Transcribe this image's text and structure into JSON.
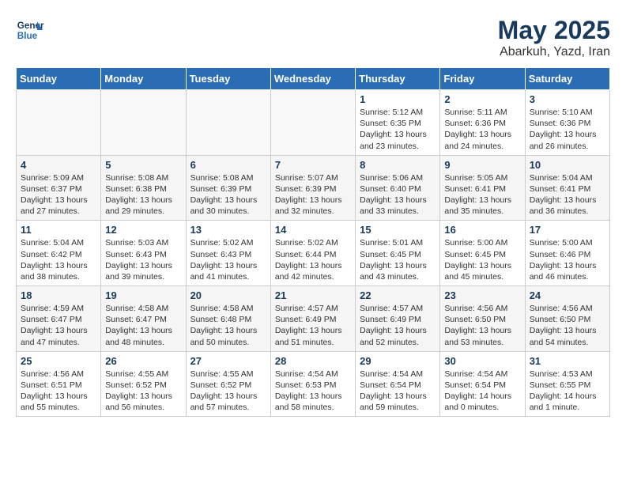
{
  "header": {
    "logo_line1": "General",
    "logo_line2": "Blue",
    "month": "May 2025",
    "location": "Abarkuh, Yazd, Iran"
  },
  "weekdays": [
    "Sunday",
    "Monday",
    "Tuesday",
    "Wednesday",
    "Thursday",
    "Friday",
    "Saturday"
  ],
  "weeks": [
    [
      {
        "day": "",
        "info": ""
      },
      {
        "day": "",
        "info": ""
      },
      {
        "day": "",
        "info": ""
      },
      {
        "day": "",
        "info": ""
      },
      {
        "day": "1",
        "info": "Sunrise: 5:12 AM\nSunset: 6:35 PM\nDaylight: 13 hours and 23 minutes."
      },
      {
        "day": "2",
        "info": "Sunrise: 5:11 AM\nSunset: 6:36 PM\nDaylight: 13 hours and 24 minutes."
      },
      {
        "day": "3",
        "info": "Sunrise: 5:10 AM\nSunset: 6:36 PM\nDaylight: 13 hours and 26 minutes."
      }
    ],
    [
      {
        "day": "4",
        "info": "Sunrise: 5:09 AM\nSunset: 6:37 PM\nDaylight: 13 hours and 27 minutes."
      },
      {
        "day": "5",
        "info": "Sunrise: 5:08 AM\nSunset: 6:38 PM\nDaylight: 13 hours and 29 minutes."
      },
      {
        "day": "6",
        "info": "Sunrise: 5:08 AM\nSunset: 6:39 PM\nDaylight: 13 hours and 30 minutes."
      },
      {
        "day": "7",
        "info": "Sunrise: 5:07 AM\nSunset: 6:39 PM\nDaylight: 13 hours and 32 minutes."
      },
      {
        "day": "8",
        "info": "Sunrise: 5:06 AM\nSunset: 6:40 PM\nDaylight: 13 hours and 33 minutes."
      },
      {
        "day": "9",
        "info": "Sunrise: 5:05 AM\nSunset: 6:41 PM\nDaylight: 13 hours and 35 minutes."
      },
      {
        "day": "10",
        "info": "Sunrise: 5:04 AM\nSunset: 6:41 PM\nDaylight: 13 hours and 36 minutes."
      }
    ],
    [
      {
        "day": "11",
        "info": "Sunrise: 5:04 AM\nSunset: 6:42 PM\nDaylight: 13 hours and 38 minutes."
      },
      {
        "day": "12",
        "info": "Sunrise: 5:03 AM\nSunset: 6:43 PM\nDaylight: 13 hours and 39 minutes."
      },
      {
        "day": "13",
        "info": "Sunrise: 5:02 AM\nSunset: 6:43 PM\nDaylight: 13 hours and 41 minutes."
      },
      {
        "day": "14",
        "info": "Sunrise: 5:02 AM\nSunset: 6:44 PM\nDaylight: 13 hours and 42 minutes."
      },
      {
        "day": "15",
        "info": "Sunrise: 5:01 AM\nSunset: 6:45 PM\nDaylight: 13 hours and 43 minutes."
      },
      {
        "day": "16",
        "info": "Sunrise: 5:00 AM\nSunset: 6:45 PM\nDaylight: 13 hours and 45 minutes."
      },
      {
        "day": "17",
        "info": "Sunrise: 5:00 AM\nSunset: 6:46 PM\nDaylight: 13 hours and 46 minutes."
      }
    ],
    [
      {
        "day": "18",
        "info": "Sunrise: 4:59 AM\nSunset: 6:47 PM\nDaylight: 13 hours and 47 minutes."
      },
      {
        "day": "19",
        "info": "Sunrise: 4:58 AM\nSunset: 6:47 PM\nDaylight: 13 hours and 48 minutes."
      },
      {
        "day": "20",
        "info": "Sunrise: 4:58 AM\nSunset: 6:48 PM\nDaylight: 13 hours and 50 minutes."
      },
      {
        "day": "21",
        "info": "Sunrise: 4:57 AM\nSunset: 6:49 PM\nDaylight: 13 hours and 51 minutes."
      },
      {
        "day": "22",
        "info": "Sunrise: 4:57 AM\nSunset: 6:49 PM\nDaylight: 13 hours and 52 minutes."
      },
      {
        "day": "23",
        "info": "Sunrise: 4:56 AM\nSunset: 6:50 PM\nDaylight: 13 hours and 53 minutes."
      },
      {
        "day": "24",
        "info": "Sunrise: 4:56 AM\nSunset: 6:50 PM\nDaylight: 13 hours and 54 minutes."
      }
    ],
    [
      {
        "day": "25",
        "info": "Sunrise: 4:56 AM\nSunset: 6:51 PM\nDaylight: 13 hours and 55 minutes."
      },
      {
        "day": "26",
        "info": "Sunrise: 4:55 AM\nSunset: 6:52 PM\nDaylight: 13 hours and 56 minutes."
      },
      {
        "day": "27",
        "info": "Sunrise: 4:55 AM\nSunset: 6:52 PM\nDaylight: 13 hours and 57 minutes."
      },
      {
        "day": "28",
        "info": "Sunrise: 4:54 AM\nSunset: 6:53 PM\nDaylight: 13 hours and 58 minutes."
      },
      {
        "day": "29",
        "info": "Sunrise: 4:54 AM\nSunset: 6:54 PM\nDaylight: 13 hours and 59 minutes."
      },
      {
        "day": "30",
        "info": "Sunrise: 4:54 AM\nSunset: 6:54 PM\nDaylight: 14 hours and 0 minutes."
      },
      {
        "day": "31",
        "info": "Sunrise: 4:53 AM\nSunset: 6:55 PM\nDaylight: 14 hours and 1 minute."
      }
    ]
  ]
}
